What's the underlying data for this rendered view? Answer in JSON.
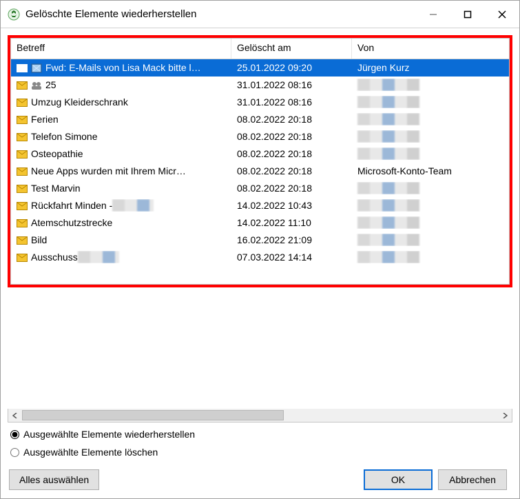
{
  "window": {
    "title": "Gelöschte Elemente wiederherstellen"
  },
  "columns": {
    "subject": "Betreff",
    "deleted": "Gelöscht am",
    "from": "Von"
  },
  "rows": [
    {
      "subject": "Fwd: E-Mails von Lisa Mack bitte l…",
      "deleted": "25.01.2022 09:20",
      "from": "Jürgen Kurz",
      "selected": true,
      "subject_icon": "attachment",
      "from_redacted": false
    },
    {
      "subject": "25",
      "deleted": "31.01.2022 08:16",
      "from": "",
      "selected": false,
      "subject_icon": "group",
      "from_redacted": true
    },
    {
      "subject": "Umzug Kleiderschrank",
      "deleted": "31.01.2022 08:16",
      "from": "",
      "selected": false,
      "from_redacted": true
    },
    {
      "subject": "Ferien",
      "deleted": "08.02.2022 20:18",
      "from": "",
      "selected": false,
      "from_redacted": true
    },
    {
      "subject": "Telefon Simone",
      "deleted": "08.02.2022 20:18",
      "from": "",
      "selected": false,
      "from_redacted": true
    },
    {
      "subject": "Osteopathie",
      "deleted": "08.02.2022 20:18",
      "from": "",
      "selected": false,
      "from_redacted": true
    },
    {
      "subject": "Neue Apps wurden mit Ihrem Micr…",
      "deleted": "08.02.2022 20:18",
      "from": "Microsoft-Konto-Team",
      "selected": false,
      "from_redacted": false
    },
    {
      "subject": "Test Marvin",
      "deleted": "08.02.2022 20:18",
      "from": "",
      "selected": false,
      "from_redacted": true
    },
    {
      "subject": "Rückfahrt Minden - ",
      "deleted": "14.02.2022 10:43",
      "from": "",
      "selected": false,
      "subject_redacted_tail": true,
      "from_redacted": true
    },
    {
      "subject": "Atemschutzstrecke",
      "deleted": "14.02.2022 11:10",
      "from": "",
      "selected": false,
      "from_redacted": true
    },
    {
      "subject": "Bild",
      "deleted": "16.02.2022 21:09",
      "from": "",
      "selected": false,
      "from_redacted": true
    },
    {
      "subject": "Ausschuss ",
      "deleted": "07.03.2022 14:14",
      "from": "",
      "selected": false,
      "subject_redacted_tail": true,
      "from_redacted": true
    }
  ],
  "options": {
    "restore": "Ausgewählte Elemente wiederherstellen",
    "delete": "Ausgewählte Elemente löschen",
    "selected": "restore"
  },
  "buttons": {
    "selectAll": "Alles auswählen",
    "ok": "OK",
    "cancel": "Abbrechen"
  },
  "colors": {
    "selection": "#0a6cd6",
    "highlightBorder": "#ff0000"
  }
}
